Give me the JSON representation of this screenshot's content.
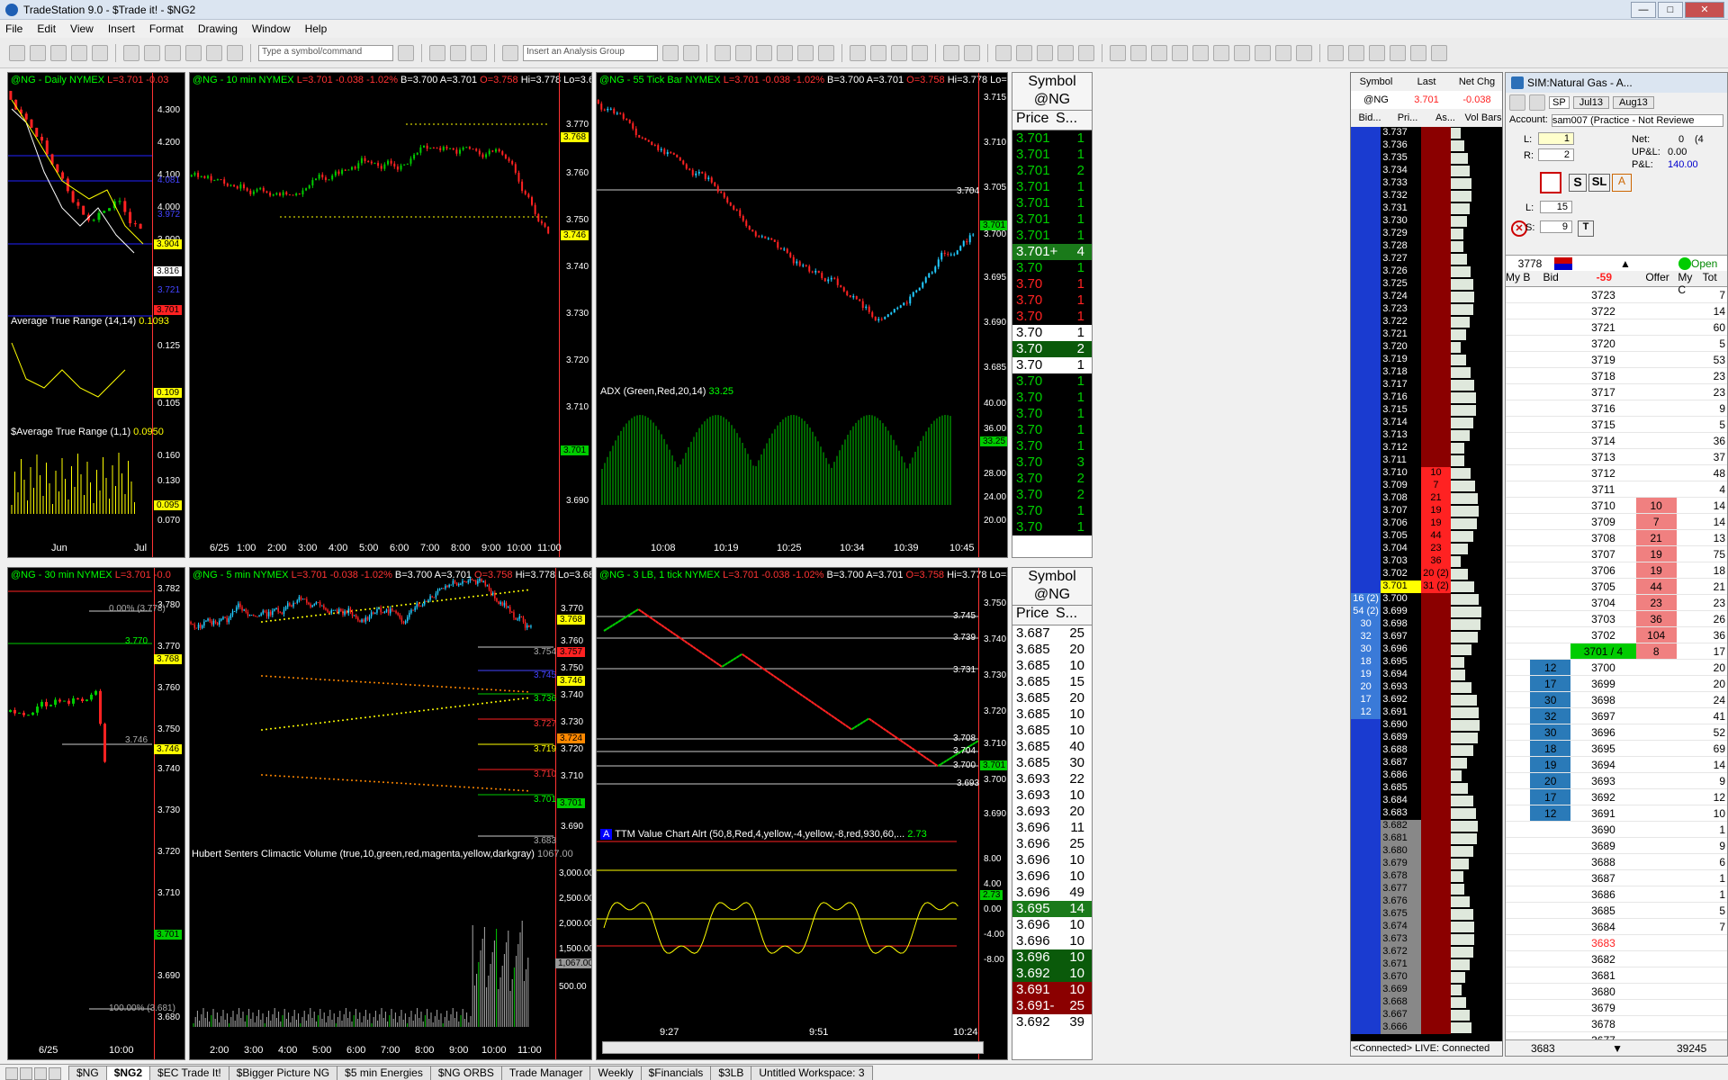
{
  "window": {
    "title": "TradeStation 9.0 - $Trade it! - $NG2"
  },
  "menu": [
    "File",
    "Edit",
    "View",
    "Insert",
    "Format",
    "Drawing",
    "Window",
    "Help"
  ],
  "toolbar": {
    "symbol_placeholder": "Type a symbol/command",
    "analysis_placeholder": "Insert an Analysis Group"
  },
  "charts": {
    "daily": {
      "h1": "@NG - Daily",
      "h2": "NYMEX",
      "h3": "L=3.701",
      "h4": "-0.03",
      "axis": [
        "4.300",
        "4.200",
        "4.100",
        "4.000",
        "3.900"
      ],
      "tags": [
        "4.081",
        "3.972",
        "3.904",
        "3.816",
        "3.721",
        "3.701"
      ],
      "ind1": "Average True Range (14,14)",
      "ind1v": "0.1093",
      "ind1axis": [
        "0.125",
        "0.109",
        "0.105"
      ],
      "ind2": "$Average True Range (1,1)",
      "ind2v": "0.0950",
      "ind2axis": [
        "0.160",
        "0.130",
        "0.095",
        "0.070"
      ],
      "x": [
        "Jun",
        "Jul"
      ]
    },
    "tenmin": {
      "h1": "@NG - 10 min",
      "h2": "NYMEX",
      "h3": "L=3.701",
      "h4": "-0.038",
      "h5": "-1.02%",
      "h6": "B=3.700",
      "h7": "A=3.701",
      "h8": "O=3.758",
      "h9": "Hi=3.778",
      "h10": "Lo=3.683",
      "h11": "V=",
      "axis": [
        "3.770",
        "3.760",
        "3.750",
        "3.740",
        "3.730",
        "3.720",
        "3.710",
        "3.690"
      ],
      "tags": [
        "3.768",
        "3.746",
        "3.701"
      ],
      "x": [
        "6/25",
        "1:00",
        "2:00",
        "3:00",
        "4:00",
        "5:00",
        "6:00",
        "7:00",
        "8:00",
        "9:00",
        "10:00",
        "11:00"
      ]
    },
    "tick": {
      "h1": "@NG - 55 Tick Bar",
      "h2": "NYMEX",
      "h3": "L=3.701",
      "h4": "-0.038",
      "h5": "-1.02%",
      "h6": "B=3.700",
      "h7": "A=3.701",
      "h8": "O=3.758",
      "h9": "Hi=3.778",
      "h10": "Lo=3.683",
      "axis": [
        "3.715",
        "3.710",
        "3.705",
        "3.700",
        "3.695",
        "3.690",
        "3.685"
      ],
      "tags": [
        "3.704",
        "3.701"
      ],
      "ind": "ADX (Green,Red,20,14)",
      "indv": "33.25",
      "indaxis": [
        "40.00",
        "36.00",
        "33.25",
        "28.00",
        "24.00",
        "20.00"
      ],
      "x": [
        "10:08",
        "10:19",
        "10:25",
        "10:34",
        "10:39",
        "10:45"
      ]
    },
    "thirty": {
      "h1": "@NG - 30 min",
      "h2": "NYMEX",
      "h3": "L=3.701",
      "h4": "-0.0",
      "axis": [
        "3.780",
        "3.770",
        "3.760",
        "3.750",
        "3.740",
        "3.730",
        "3.720",
        "3.710",
        "3.690",
        "3.680"
      ],
      "tags": [
        "3.782",
        "3.770",
        "3.768",
        "3.746",
        "3.701"
      ],
      "fib1": "0.00% (3.778)",
      "fib2": "100.00% (3.681)",
      "x": [
        "6/25",
        "10:00"
      ]
    },
    "fivemin": {
      "h1": "@NG - 5 min",
      "h2": "NYMEX",
      "h3": "L=3.701",
      "h4": "-0.038",
      "h5": "-1.02%",
      "h6": "B=3.700",
      "h7": "A=3.701",
      "h8": "O=3.758",
      "h9": "Hi=3.778",
      "h10": "Lo=3.683",
      "h11": "V",
      "axis": [
        "3.770",
        "3.760",
        "3.750",
        "3.740",
        "3.730",
        "3.720",
        "3.710",
        "3.690"
      ],
      "tags": [
        "3.768",
        "3.757",
        "3.754",
        "3.745",
        "3.746",
        "3.736",
        "3.727",
        "3.724",
        "3.719",
        "3.710",
        "3.701",
        "3.683"
      ],
      "ind": "Hubert Senters Climactic Volume (true,10,green,red,magenta,yellow,darkgray)",
      "indv": "1067.00",
      "indaxis": [
        "3,000.00",
        "2,500.00",
        "2,000.00",
        "1,500.00",
        "1,067.00",
        "500.00"
      ],
      "x": [
        "2:00",
        "3:00",
        "4:00",
        "5:00",
        "6:00",
        "7:00",
        "8:00",
        "9:00",
        "10:00",
        "11:00"
      ]
    },
    "lb3": {
      "h1": "@NG - 3 LB, 1 tick",
      "h2": "NYMEX",
      "h3": "L=3.701",
      "h4": "-0.038",
      "h5": "-1.02%",
      "h6": "B=3.700",
      "h7": "A=3.701",
      "h8": "O=3.758",
      "h9": "Hi=3.778",
      "h10": "Lo=3.683",
      "axis": [
        "3.750",
        "3.740",
        "3.730",
        "3.720",
        "3.710",
        "3.700",
        "3.690"
      ],
      "tags": [
        "3.745",
        "3.739",
        "3.731",
        "3.708",
        "3.704",
        "3.700",
        "3.701",
        "3.693"
      ],
      "ind": "TTM Value Chart Alrt (50,8,Red,4,yellow,-4,yellow,-8,red,930,60,...",
      "indv": "2.73",
      "indaxis": [
        "8.00",
        "4.00",
        "2.73",
        "0.00",
        "-4.00",
        "-8.00"
      ],
      "x": [
        "9:27",
        "9:51",
        "10:24"
      ]
    }
  },
  "ts1": {
    "title": "Symbol",
    "symbol": "@NG",
    "col_price": "Price",
    "col_size": "S...",
    "rows": [
      [
        "3.701",
        "1",
        "g"
      ],
      [
        "3.701",
        "1",
        "g"
      ],
      [
        "3.701",
        "2",
        "g"
      ],
      [
        "3.701",
        "1",
        "g"
      ],
      [
        "3.701",
        "1",
        "g"
      ],
      [
        "3.701",
        "1",
        "g"
      ],
      [
        "3.701",
        "1",
        "g"
      ],
      [
        "3.701+",
        "4",
        "hl"
      ],
      [
        "3.70",
        "1",
        "g"
      ],
      [
        "3.70",
        "1",
        "r"
      ],
      [
        "3.70",
        "1",
        "r"
      ],
      [
        "3.70",
        "1",
        "r"
      ],
      [
        "3.70",
        "1",
        "wk"
      ],
      [
        "3.70",
        "2",
        "gb"
      ],
      [
        "3.70",
        "1",
        "wk"
      ],
      [
        "3.70",
        "1",
        "g"
      ],
      [
        "3.70",
        "1",
        "g"
      ],
      [
        "3.70",
        "1",
        "g"
      ],
      [
        "3.70",
        "1",
        "g"
      ],
      [
        "3.70",
        "1",
        "g"
      ],
      [
        "3.70",
        "3",
        "g"
      ],
      [
        "3.70",
        "2",
        "g"
      ],
      [
        "3.70",
        "2",
        "g"
      ],
      [
        "3.70",
        "1",
        "g"
      ],
      [
        "3.70",
        "1",
        "g"
      ]
    ]
  },
  "ts2": {
    "title": "Symbol",
    "symbol": "@NG",
    "col_price": "Price",
    "col_size": "S...",
    "rows": [
      [
        "3.687",
        "25",
        "wk"
      ],
      [
        "3.685",
        "20",
        "wk"
      ],
      [
        "3.685",
        "10",
        "wk"
      ],
      [
        "3.685",
        "15",
        "wk"
      ],
      [
        "3.685",
        "20",
        "wk"
      ],
      [
        "3.685",
        "10",
        "wk"
      ],
      [
        "3.685",
        "10",
        "wk"
      ],
      [
        "3.685",
        "40",
        "wk"
      ],
      [
        "3.685",
        "30",
        "wk"
      ],
      [
        "3.693",
        "22",
        "wk"
      ],
      [
        "3.693",
        "10",
        "wk"
      ],
      [
        "3.693",
        "20",
        "wk"
      ],
      [
        "3.696",
        "11",
        "wk"
      ],
      [
        "3.696",
        "25",
        "wk"
      ],
      [
        "3.696",
        "10",
        "wk"
      ],
      [
        "3.696",
        "10",
        "wk"
      ],
      [
        "3.696",
        "49",
        "wk"
      ],
      [
        "3.695",
        "14",
        "hl"
      ],
      [
        "3.696",
        "10",
        "wk"
      ],
      [
        "3.696",
        "10",
        "wk"
      ],
      [
        "3.696",
        "10",
        "gb"
      ],
      [
        "3.692",
        "10",
        "gb"
      ],
      [
        "3.691",
        "10",
        "rb"
      ],
      [
        "3.691-",
        "25",
        "rb"
      ],
      [
        "3.692",
        "39",
        "wk"
      ]
    ]
  },
  "radar": {
    "h_symbol": "Symbol",
    "h_last": "Last",
    "h_netchg": "Net Chg",
    "symbol": "@NG",
    "last": "3.701",
    "netchg": "-0.038",
    "c_bid": "Bid...",
    "c_pri": "Pri...",
    "c_ask": "As...",
    "c_vol": "Vol Bars",
    "prices": [
      "3.737",
      "3.736",
      "3.735",
      "3.734",
      "3.733",
      "3.732",
      "3.731",
      "3.730",
      "3.729",
      "3.728",
      "3.727",
      "3.726",
      "3.725",
      "3.724",
      "3.723",
      "3.722",
      "3.721",
      "3.720",
      "3.719",
      "3.718",
      "3.717",
      "3.716",
      "3.715",
      "3.714",
      "3.713",
      "3.712",
      "3.711",
      "3.710",
      "3.709",
      "3.708",
      "3.707",
      "3.706",
      "3.705",
      "3.704",
      "3.703",
      "3.702",
      "3.701",
      "3.700",
      "3.699",
      "3.698",
      "3.697",
      "3.696",
      "3.695",
      "3.694",
      "3.693",
      "3.692",
      "3.691",
      "3.690",
      "3.689",
      "3.688",
      "3.687",
      "3.686",
      "3.685",
      "3.684",
      "3.683",
      "3.682",
      "3.681",
      "3.680",
      "3.679",
      "3.678",
      "3.677",
      "3.676",
      "3.675",
      "3.674",
      "3.673",
      "3.672",
      "3.671",
      "3.670",
      "3.669",
      "3.668",
      "3.667",
      "3.666"
    ],
    "asks": {
      "3.710": "10",
      "3.709": "7",
      "3.708": "21",
      "3.707": "19",
      "3.706": "19",
      "3.705": "44",
      "3.704": "23",
      "3.703": "36",
      "3.702": "20 (2)",
      "3.701": "31 (2)"
    },
    "bids": {
      "3.700": "16 (2)",
      "3.699": "54 (2)",
      "3.698": "30",
      "3.697": "32",
      "3.696": "30",
      "3.695": "18",
      "3.694": "19",
      "3.693": "20",
      "3.692": "17",
      "3.691": "12"
    },
    "status": "<Connected> LIVE: Connected"
  },
  "dom": {
    "title": "SIM:Natural Gas - A...",
    "route": "SP",
    "m1": "Jul13",
    "m2": "Aug13",
    "account_label": "Account:",
    "account": "sam007 (Practice - Not Reviewe",
    "l_label": "L:",
    "l_val": "1",
    "r_label": "R:",
    "r_val": "2",
    "net_label": "Net:",
    "net": "0",
    "net2": "(4",
    "upl_label": "UP&L:",
    "upl": "0.00",
    "pl_label": "P&L:",
    "pl": "140.00",
    "L2_label": "L:",
    "L2": "15",
    "S_label": "S:",
    "S": "9",
    "btn_s": "S",
    "btn_sl": "SL",
    "btn_t": "T",
    "qty": "3778",
    "delta": "-59",
    "open": "Open",
    "cols": [
      "My B",
      "Bid",
      "",
      "Offer",
      "My C",
      "Tot"
    ],
    "rows": [
      [
        "",
        "",
        "3723",
        "",
        "",
        "7"
      ],
      [
        "",
        "",
        "3722",
        "",
        "",
        "14"
      ],
      [
        "",
        "",
        "3721",
        "",
        "",
        "60"
      ],
      [
        "",
        "",
        "3720",
        "",
        "",
        "5"
      ],
      [
        "",
        "",
        "3719",
        "",
        "",
        "53"
      ],
      [
        "",
        "",
        "3718",
        "",
        "",
        "23"
      ],
      [
        "",
        "",
        "3717",
        "",
        "",
        "23"
      ],
      [
        "",
        "",
        "3716",
        "",
        "",
        "9"
      ],
      [
        "",
        "",
        "3715",
        "",
        "",
        "5"
      ],
      [
        "",
        "",
        "3714",
        "",
        "",
        "36"
      ],
      [
        "",
        "",
        "3713",
        "",
        "",
        "37"
      ],
      [
        "",
        "",
        "3712",
        "",
        "",
        "48"
      ],
      [
        "",
        "",
        "3711",
        "",
        "",
        "4"
      ],
      [
        "",
        "",
        "3710",
        "10",
        "",
        "14"
      ],
      [
        "",
        "",
        "3709",
        "7",
        "",
        "14"
      ],
      [
        "",
        "",
        "3708",
        "21",
        "",
        "13"
      ],
      [
        "",
        "",
        "3707",
        "19",
        "",
        "75"
      ],
      [
        "",
        "",
        "3706",
        "19",
        "",
        "18"
      ],
      [
        "",
        "",
        "3705",
        "44",
        "",
        "21"
      ],
      [
        "",
        "",
        "3704",
        "23",
        "",
        "23"
      ],
      [
        "",
        "",
        "3703",
        "36",
        "",
        "26"
      ],
      [
        "",
        "",
        "3702",
        "104",
        "",
        "36"
      ],
      [
        "",
        "",
        "3701 / 4",
        "8",
        "",
        "17"
      ],
      [
        "",
        "12",
        "3700",
        "",
        "",
        "20"
      ],
      [
        "",
        "17",
        "3699",
        "",
        "",
        "20"
      ],
      [
        "",
        "30",
        "3698",
        "",
        "",
        "24"
      ],
      [
        "",
        "32",
        "3697",
        "",
        "",
        "41"
      ],
      [
        "",
        "30",
        "3696",
        "",
        "",
        "52"
      ],
      [
        "",
        "18",
        "3695",
        "",
        "",
        "69"
      ],
      [
        "",
        "19",
        "3694",
        "",
        "",
        "14"
      ],
      [
        "",
        "20",
        "3693",
        "",
        "",
        "9"
      ],
      [
        "",
        "17",
        "3692",
        "",
        "",
        "12"
      ],
      [
        "",
        "12",
        "3691",
        "",
        "",
        "10"
      ],
      [
        "",
        "",
        "3690",
        "",
        "",
        "1"
      ],
      [
        "",
        "",
        "3689",
        "",
        "",
        "9"
      ],
      [
        "",
        "",
        "3688",
        "",
        "",
        "6"
      ],
      [
        "",
        "",
        "3687",
        "",
        "",
        "1"
      ],
      [
        "",
        "",
        "3686",
        "",
        "",
        "1"
      ],
      [
        "",
        "",
        "3685",
        "",
        "",
        "5"
      ],
      [
        "",
        "",
        "3684",
        "",
        "",
        "7"
      ],
      [
        "",
        "",
        "3683",
        "",
        "",
        ""
      ],
      [
        "",
        "",
        "3682",
        "",
        "",
        ""
      ],
      [
        "",
        "",
        "3681",
        "",
        "",
        ""
      ],
      [
        "",
        "",
        "3680",
        "",
        "",
        ""
      ],
      [
        "",
        "",
        "3679",
        "",
        "",
        ""
      ],
      [
        "",
        "",
        "3678",
        "",
        "",
        ""
      ],
      [
        "",
        "",
        "3677",
        "",
        "",
        ""
      ]
    ],
    "foot_left": "3683",
    "foot_right": "39245"
  },
  "tabs": [
    "$NG",
    "$NG2",
    "$EC Trade It!",
    "$Bigger Picture NG",
    "$5 min Energies",
    "$NG ORBS",
    "Trade Manager",
    "Weekly",
    "$Financials",
    "$3LB",
    "Untitled Workspace: 3"
  ]
}
